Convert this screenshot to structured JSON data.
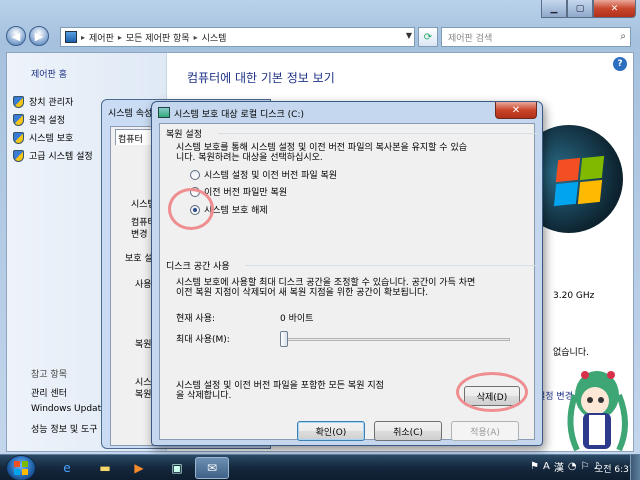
{
  "explorer": {
    "breadcrumb": [
      "제어판",
      "모든 제어판 항목",
      "시스템"
    ],
    "search_placeholder": "제어판 검색",
    "left_pane": {
      "home_link": "제어판 홈",
      "tasks": [
        "장치 관리자",
        "원격 설정",
        "시스템 보호",
        "고급 시스템 설정"
      ],
      "see_also_header": "참고 항목",
      "see_also_links": [
        "관리 센터",
        "Windows Update",
        "성능 정보 및 도구"
      ]
    },
    "main": {
      "title": "컴퓨터에 대한 기본 정보 보기",
      "processor_speed": "3.20 GHz",
      "pen_touch": "없습니다.",
      "change_link": "설정 변경"
    }
  },
  "system_properties": {
    "title": "시스템 속성",
    "tab": "컴퓨터",
    "texts": [
      "시스템",
      "컴퓨터",
      "변경",
      "보호 설정",
      "사용",
      "복원",
      "시스",
      "복원"
    ]
  },
  "dialog": {
    "title": "시스템 보호 대상 로컬 디스크 (C:)",
    "restore_settings": {
      "header": "복원 설정",
      "description_line1": "시스템 보호를 통해 시스템 설정 및 이전 버전 파일의 복사본을 유지할 수 있습",
      "description_line2": "니다. 복원하려는 대상을 선택하십시오.",
      "options": [
        {
          "label": "시스템 설정 및 이전 버전 파일 복원",
          "checked": false
        },
        {
          "label": "이전 버전 파일만 복원",
          "checked": false
        },
        {
          "label": "시스템 보호 해제",
          "checked": true
        }
      ]
    },
    "disk_usage": {
      "header": "디스크 공간 사용",
      "description_line1": "시스템 보호에 사용할 최대 디스크 공간을 조정할 수 있습니다. 공간이 가득 차면",
      "description_line2": "이전 복원 지점이 삭제되어 새 복원 지점을 위한 공간이 확보됩니다.",
      "current_usage_label": "현재 사용:",
      "current_usage_value": "0 바이트",
      "max_usage_label": "최대 사용(M):",
      "slider_level_percent": 0
    },
    "delete_section": {
      "text_line1": "시스템 설정 및 이전 버전 파일을 포함한 모든 복원 지점",
      "text_line2": "을 삭제합니다.",
      "delete_button": "삭제(D)"
    },
    "buttons": {
      "ok": "확인(O)",
      "cancel": "취소(C)",
      "apply": "적용(A)"
    }
  },
  "taskbar": {
    "tray_lang": "A",
    "tray_hanja": "漢",
    "clock": "오전 6:37"
  },
  "colors": {
    "link_blue": "#1e3287",
    "highlight_circle": "#ef8e90",
    "title_bar": "#c4d7ee"
  }
}
